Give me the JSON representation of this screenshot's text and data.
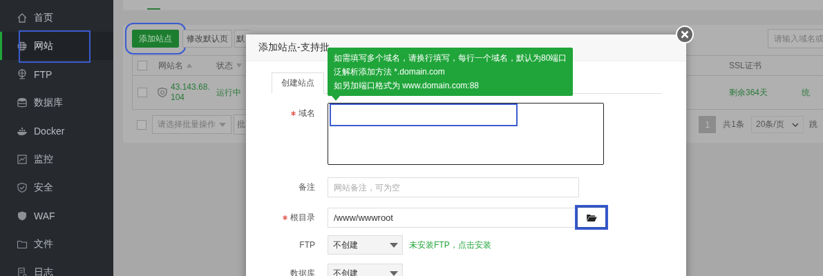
{
  "sidebar": {
    "items": [
      {
        "label": "首页",
        "selected": false,
        "highlighted": false
      },
      {
        "label": "网站",
        "selected": true,
        "highlighted": true
      },
      {
        "label": "FTP",
        "selected": false,
        "highlighted": false
      },
      {
        "label": "数据库",
        "selected": false,
        "highlighted": false
      },
      {
        "label": "Docker",
        "selected": false,
        "highlighted": false
      },
      {
        "label": "监控",
        "selected": false,
        "highlighted": false
      },
      {
        "label": "安全",
        "selected": false,
        "highlighted": false
      },
      {
        "label": "WAF",
        "selected": false,
        "highlighted": false
      },
      {
        "label": "文件",
        "selected": false,
        "highlighted": false
      },
      {
        "label": "日志",
        "selected": false,
        "highlighted": false
      }
    ]
  },
  "toolbar": {
    "buttons": [
      {
        "label": "添加站点",
        "kind": "primary",
        "highlighted": true
      },
      {
        "label": "修改默认页",
        "kind": "default",
        "highlighted": false
      },
      {
        "label": "默",
        "kind": "default",
        "highlighted": false
      }
    ],
    "search": {
      "placeholder": "请输入域名或"
    }
  },
  "table": {
    "header_checked": false,
    "columns": [
      {
        "label": "网站名",
        "ascending": true
      },
      {
        "label": "状态",
        "ascending": false
      },
      {
        "label": "SSL证书"
      }
    ],
    "rows": [
      {
        "checked": false,
        "name": "43.143.68.104",
        "status": "运行中",
        "ssl": "剩余364天",
        "column_5": "统"
      }
    ]
  },
  "footer": {
    "checked": false,
    "batch_select": {
      "placeholder": "请选择批量操作"
    },
    "batch_button": "批",
    "pagination": {
      "pages": [
        {
          "label": "1",
          "selected": true
        }
      ],
      "total": "共1条",
      "page_size": "20条/页",
      "jump": "跳"
    }
  },
  "dialog": {
    "title": "添加站点-支持批",
    "tabs": [
      {
        "label": "创建站点",
        "selected": true
      }
    ],
    "tooltip": {
      "lines": [
        "如需填写多个域名，请换行填写，每行一个域名，默认为80端口",
        "泛解析添加方法 *.domain.com",
        "如另加端口格式为 www.domain.com:88"
      ]
    },
    "fields": [
      {
        "kind": "textarea",
        "label": "域名",
        "required": true,
        "highlighted": true
      },
      {
        "kind": "text",
        "label": "备注",
        "required": false,
        "highlighted": false,
        "placeholder": "网站备注，可为空"
      },
      {
        "kind": "path",
        "label": "根目录",
        "required": true,
        "highlighted": true,
        "value": "/www/wwwroot"
      },
      {
        "kind": "select",
        "label": "FTP",
        "required": false,
        "highlighted": false,
        "value": "不创建",
        "link": "未安装FTP，点击安装"
      },
      {
        "kind": "select",
        "label": "数据库",
        "required": false,
        "highlighted": false,
        "value": "不创建"
      }
    ]
  }
}
